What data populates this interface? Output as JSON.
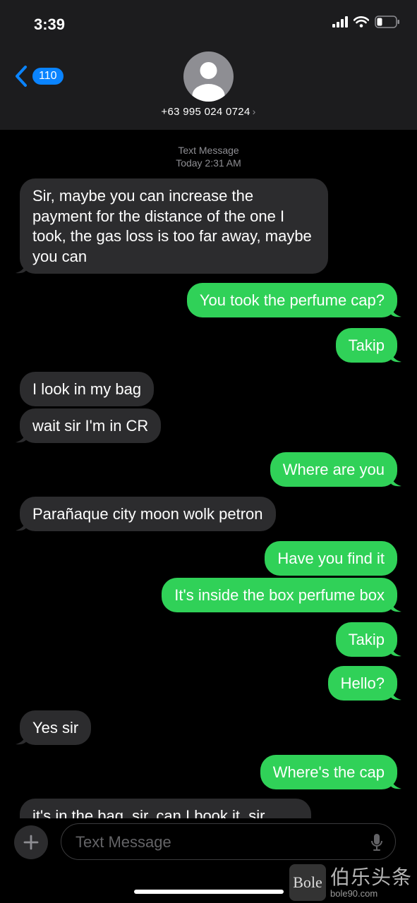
{
  "status_bar": {
    "time": "3:39"
  },
  "header": {
    "back_badge": "110",
    "contact_number": "+63 995 024 0724",
    "contact_chevron": "›"
  },
  "thread": {
    "meta_type": "Text Message",
    "meta_time": "Today 2:31 AM",
    "messages": [
      {
        "from": "them",
        "text": "Sir, maybe you can increase the payment for the distance of the one I took, the gas loss is too far away, maybe you can"
      },
      {
        "from": "me",
        "text": "You took the perfume cap?"
      },
      {
        "from": "me",
        "text": "Takip"
      },
      {
        "from": "them",
        "text": "I look in my bag"
      },
      {
        "from": "them",
        "text": "wait sir I'm in CR"
      },
      {
        "from": "me",
        "text": "Where are you"
      },
      {
        "from": "them",
        "text": "Parañaque city moon wolk petron"
      },
      {
        "from": "me",
        "text": "Have you find it"
      },
      {
        "from": "me",
        "text": "It's inside the box perfume box"
      },
      {
        "from": "me",
        "text": "Takip"
      },
      {
        "from": "me",
        "text": "Hello?"
      },
      {
        "from": "them",
        "text": "Yes sir"
      },
      {
        "from": "me",
        "text": "Where's the cap"
      },
      {
        "from": "them",
        "text": "it's in the bag, sir, can I book it, sir"
      }
    ]
  },
  "composer": {
    "placeholder": "Text Message",
    "plus_icon": "plus-icon",
    "mic_icon": "microphone-icon"
  },
  "watermark": {
    "logo": "Bole",
    "cn": "伯乐头条",
    "url": "bole90.com"
  },
  "colors": {
    "sent": "#30d158",
    "received": "#2c2c2e",
    "header": "#1c1c1e",
    "accent": "#0a84ff"
  }
}
